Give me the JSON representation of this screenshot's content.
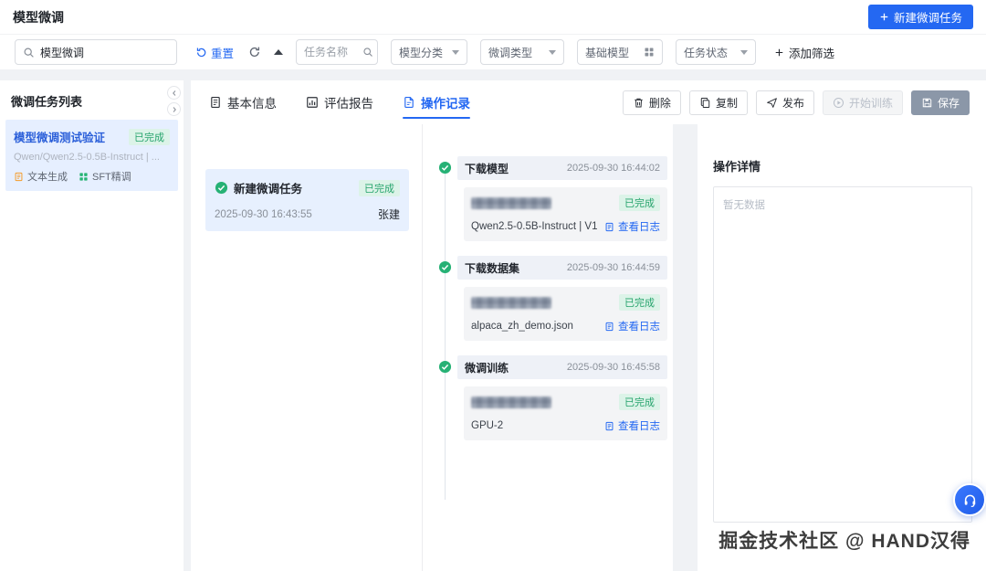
{
  "colors": {
    "accent": "#2468f2",
    "success_text": "#27a46d",
    "success_bg": "#dcf3e8"
  },
  "header": {
    "title": "模型微调",
    "new_task_button": "新建微调任务"
  },
  "filter_bar": {
    "search_value": "模型微调",
    "reset": "重置",
    "task_name_placeholder": "任务名称",
    "model_category": "模型分类",
    "finetune_type": "微调类型",
    "base_model": "基础模型",
    "task_status": "任务状态",
    "add_filter": "添加筛选"
  },
  "sidebar": {
    "title": "微调任务列表",
    "task": {
      "name": "模型微调测试验证",
      "status": "已完成",
      "model": "Qwen/Qwen2.5-0.5B-Instruct | ...",
      "tags": [
        "文本生成",
        "SFT精调"
      ]
    }
  },
  "tabs": {
    "basic_info": "基本信息",
    "eval_report": "评估报告",
    "operation_record": "操作记录"
  },
  "toolbar": {
    "delete": "删除",
    "copy": "复制",
    "publish": "发布",
    "start_training": "开始训练",
    "save": "保存"
  },
  "flow": {
    "root": {
      "title": "新建微调任务",
      "status": "已完成",
      "time": "2025-09-30 16:43:55",
      "owner": "张建"
    },
    "steps": [
      {
        "title": "下载模型",
        "time": "2025-09-30 16:44:02",
        "status": "已完成",
        "detail": "Qwen2.5-0.5B-Instruct | V1",
        "log": "查看日志"
      },
      {
        "title": "下载数据集",
        "time": "2025-09-30 16:44:59",
        "status": "已完成",
        "detail": "alpaca_zh_demo.json",
        "log": "查看日志"
      },
      {
        "title": "微调训练",
        "time": "2025-09-30 16:45:58",
        "status": "已完成",
        "detail": "GPU-2",
        "log": "查看日志"
      }
    ]
  },
  "details": {
    "title": "操作详情",
    "empty": "暂无数据"
  },
  "watermark": "掘金技术社区 @ HAND汉得"
}
